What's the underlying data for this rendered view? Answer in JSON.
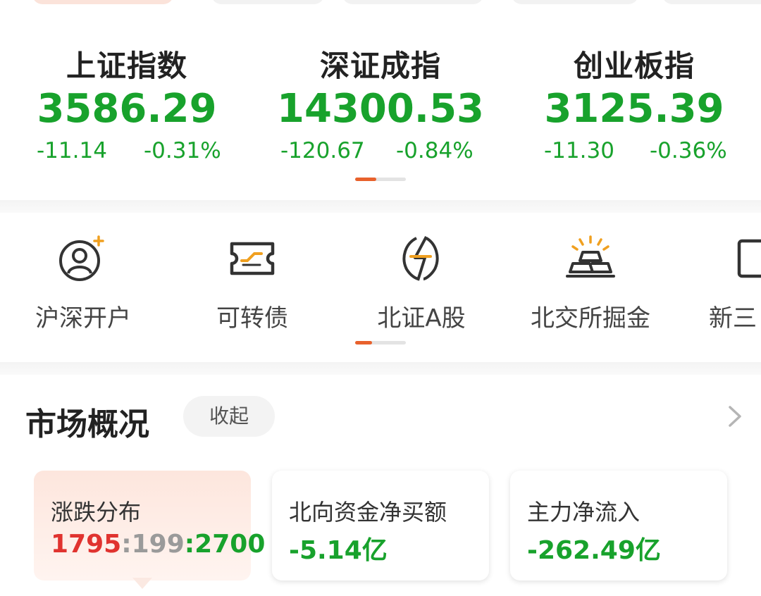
{
  "indices": [
    {
      "name": "上证指数",
      "value": "3586.29",
      "change": "-11.14",
      "pct": "-0.31%"
    },
    {
      "name": "深证成指",
      "value": "14300.53",
      "change": "-120.67",
      "pct": "-0.84%"
    },
    {
      "name": "创业板指",
      "value": "3125.39",
      "change": "-11.30",
      "pct": "-0.36%"
    }
  ],
  "shortcuts": [
    {
      "label": "沪深开户",
      "icon": "user-add-icon"
    },
    {
      "label": "可转债",
      "icon": "ticket-icon"
    },
    {
      "label": "北证A股",
      "icon": "lightning-globe-icon"
    },
    {
      "label": "北交所掘金",
      "icon": "gold-bars-icon"
    },
    {
      "label": "新三",
      "icon": "board-icon"
    }
  ],
  "overview": {
    "title": "市场概况",
    "collapse_label": "收起",
    "cards": [
      {
        "title": "涨跌分布",
        "up": "1795",
        "sep1": ":",
        "flat": "199",
        "sep2": ":",
        "down": "2700"
      },
      {
        "title": "北向资金净买额",
        "value": "-5.14亿"
      },
      {
        "title": "主力净流入",
        "value": "-262.49亿"
      }
    ]
  },
  "colors": {
    "down_green": "#18a22c",
    "up_red": "#e0332f",
    "accent_orange": "#e8612c"
  }
}
